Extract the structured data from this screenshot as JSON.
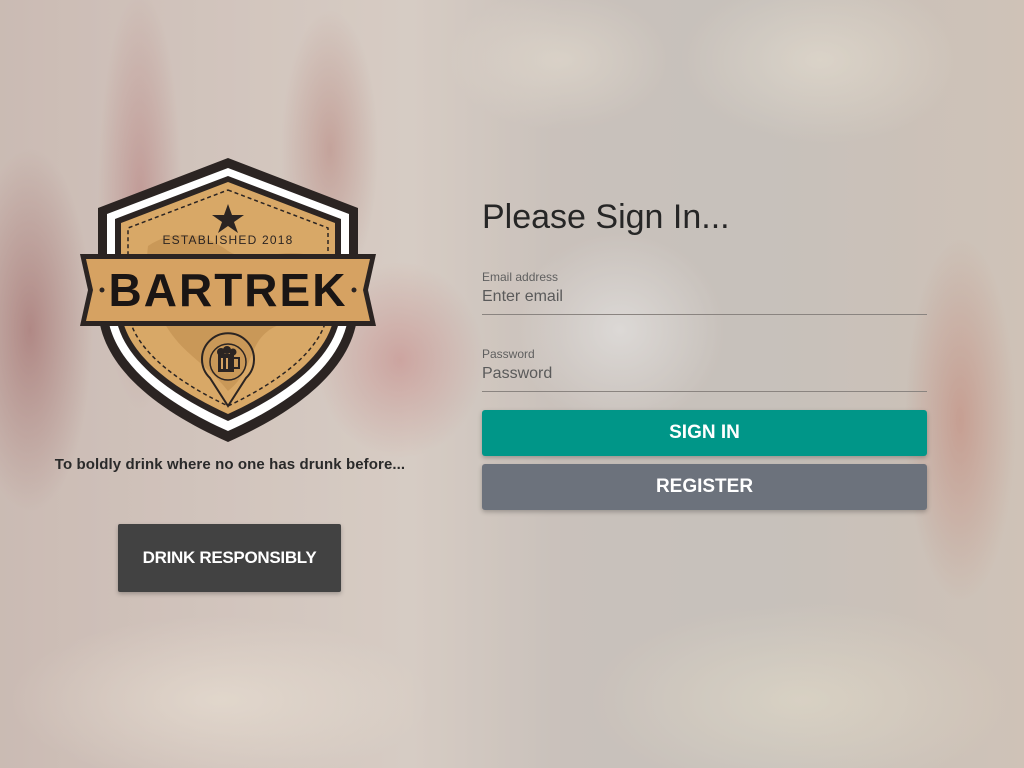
{
  "logo": {
    "established": "ESTABLISHED 2018",
    "name": "BARTREK"
  },
  "tagline": "To boldly drink where no one has drunk before...",
  "drink_button_label": "DRINK RESPONSIBLY",
  "form": {
    "title": "Please Sign In...",
    "email": {
      "label": "Email address",
      "placeholder": "Enter email"
    },
    "password": {
      "label": "Password",
      "placeholder": "Password"
    },
    "signin_label": "SIGN IN",
    "register_label": "REGISTER"
  },
  "colors": {
    "signin": "#009688",
    "register": "#6c727c",
    "drink_button": "#424242"
  },
  "icons": [
    "star-icon",
    "beer-location-icon"
  ]
}
